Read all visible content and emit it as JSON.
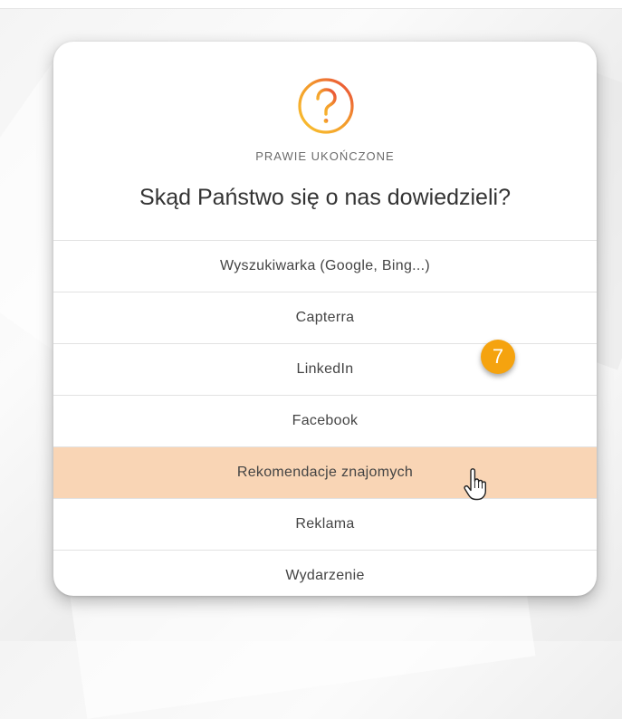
{
  "card": {
    "subtitle": "PRAWIE UKOŃCZONE",
    "title": "Skąd Państwo się o nas dowiedzieli?",
    "options": [
      {
        "label": "Wyszukiwarka (Google, Bing...)"
      },
      {
        "label": "Capterra"
      },
      {
        "label": "LinkedIn"
      },
      {
        "label": "Facebook"
      },
      {
        "label": "Rekomendacje znajomych"
      },
      {
        "label": "Reklama"
      },
      {
        "label": "Wydarzenie"
      }
    ]
  },
  "step_badge": "7",
  "icons": {
    "question": "question-circle-icon",
    "cursor": "hand-pointer-cursor-icon"
  },
  "colors": {
    "highlight": "#f9d5b5",
    "badge": "#f5a30f",
    "icon_gradient_start": "#f7b52b",
    "icon_gradient_end": "#e8473a"
  }
}
